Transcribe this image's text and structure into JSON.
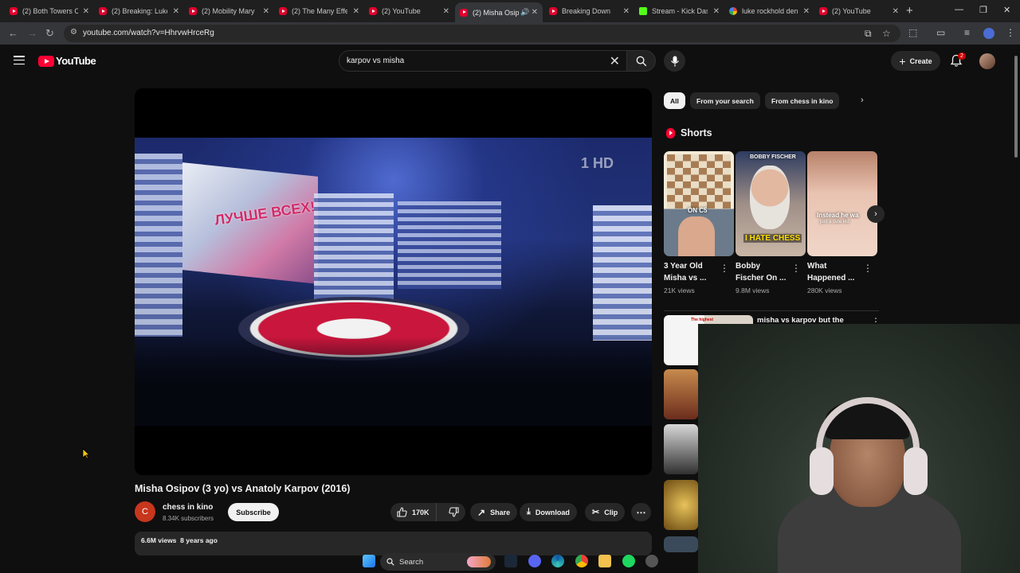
{
  "browser": {
    "tabs": [
      {
        "label": "(2) Both Towers C",
        "favicon": "youtube"
      },
      {
        "label": "(2) Breaking: Luke",
        "favicon": "youtube"
      },
      {
        "label": "(2) Mobility Mary",
        "favicon": "youtube"
      },
      {
        "label": "(2) The Many Effe",
        "favicon": "youtube"
      },
      {
        "label": "(2) YouTube",
        "favicon": "youtube"
      },
      {
        "label": "(2) Misha Osip",
        "favicon": "youtube",
        "active": true
      },
      {
        "label": "Breaking Down",
        "favicon": "youtube"
      },
      {
        "label": "Stream - Kick Das",
        "favicon": "kick"
      },
      {
        "label": "luke rockhold den",
        "favicon": "google"
      },
      {
        "label": "(2) YouTube",
        "favicon": "youtube"
      }
    ],
    "url": "youtube.com/watch?v=HhrvwHrceRg"
  },
  "masthead": {
    "logo_text": "YouTube",
    "search_query": "karpov vs misha",
    "create_label": "Create",
    "notification_count": "2"
  },
  "video": {
    "title": "Misha Osipov (3 yo) vs Anatoly Karpov (2016)",
    "channel_initial": "C",
    "channel_name": "chess in kino",
    "subscribers": "8.34K subscribers",
    "subscribe_label": "Subscribe",
    "likes": "170K",
    "share_label": "Share",
    "download_label": "Download",
    "clip_label": "Clip",
    "views": "6.6M views",
    "age": "8 years ago",
    "frame_text": {
      "sign": "ЛУЧШЕ ВСЕХ!",
      "watermark": "1 HD"
    }
  },
  "filters": {
    "chips": [
      "All",
      "From your search",
      "From chess in kino"
    ],
    "selected": "All"
  },
  "shorts": {
    "heading": "Shorts",
    "items": [
      {
        "title_line1": "3 Year Old",
        "title_line2": "Misha vs ...",
        "views": "21K views",
        "thumb_caption": "ON C5"
      },
      {
        "title_line1": "Bobby",
        "title_line2": "Fischer On ...",
        "views": "9.8M views",
        "thumb_caption_top": "BOBBY FISCHER",
        "thumb_caption": "I HATE CHESS"
      },
      {
        "title_line1": "What",
        "title_line2": "Happened ...",
        "views": "280K views",
        "thumb_caption": "Instead he wa",
        "thumb_caption_small": "just a cute kid"
      }
    ]
  },
  "recommended": {
    "first_title": "misha vs karpov but the",
    "first_thumb_caption": "The highest"
  },
  "taskbar": {
    "search_label": "Search"
  },
  "colors": {
    "background": "#0f0f0f",
    "youtube_red": "#ff0033",
    "chip_bg": "#272727"
  }
}
